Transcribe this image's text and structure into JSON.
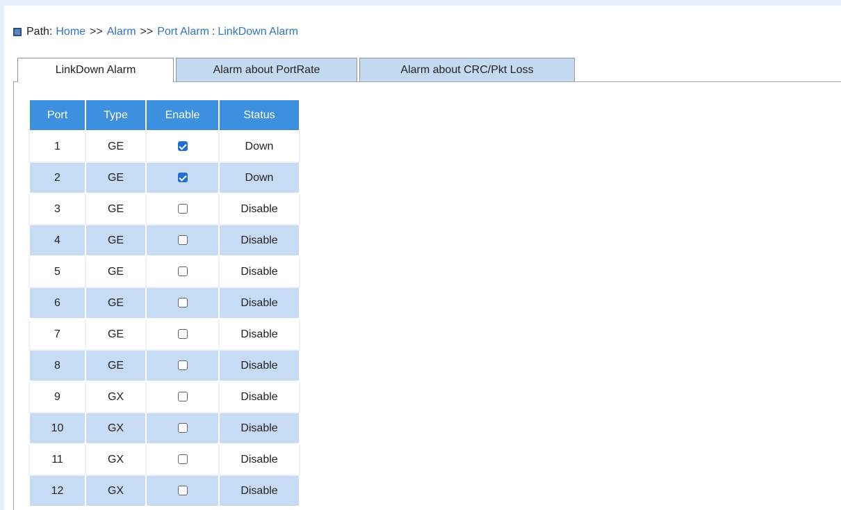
{
  "path": {
    "label": "Path:",
    "crumbs": [
      "Home",
      "Alarm",
      "Port Alarm"
    ],
    "separator": ">>",
    "current_sep": ":",
    "current": "LinkDown Alarm"
  },
  "tabs": [
    {
      "label": "LinkDown Alarm",
      "active": true
    },
    {
      "label": "Alarm about PortRate",
      "active": false
    },
    {
      "label": "Alarm about CRC/Pkt Loss",
      "active": false
    }
  ],
  "table": {
    "headers": [
      "Port",
      "Type",
      "Enable",
      "Status"
    ],
    "rows": [
      {
        "port": "1",
        "type": "GE",
        "enabled": true,
        "status": "Down"
      },
      {
        "port": "2",
        "type": "GE",
        "enabled": true,
        "status": "Down"
      },
      {
        "port": "3",
        "type": "GE",
        "enabled": false,
        "status": "Disable"
      },
      {
        "port": "4",
        "type": "GE",
        "enabled": false,
        "status": "Disable"
      },
      {
        "port": "5",
        "type": "GE",
        "enabled": false,
        "status": "Disable"
      },
      {
        "port": "6",
        "type": "GE",
        "enabled": false,
        "status": "Disable"
      },
      {
        "port": "7",
        "type": "GE",
        "enabled": false,
        "status": "Disable"
      },
      {
        "port": "8",
        "type": "GE",
        "enabled": false,
        "status": "Disable"
      },
      {
        "port": "9",
        "type": "GX",
        "enabled": false,
        "status": "Disable"
      },
      {
        "port": "10",
        "type": "GX",
        "enabled": false,
        "status": "Disable"
      },
      {
        "port": "11",
        "type": "GX",
        "enabled": false,
        "status": "Disable"
      },
      {
        "port": "12",
        "type": "GX",
        "enabled": false,
        "status": "Disable"
      }
    ]
  },
  "colors": {
    "header_bg": "#3d8fe0",
    "row_alt_bg": "#c7dbf5",
    "tab_inactive_bg": "#c5d9f1",
    "link": "#2f74c0",
    "checkbox_checked": "#1f6fd1"
  }
}
